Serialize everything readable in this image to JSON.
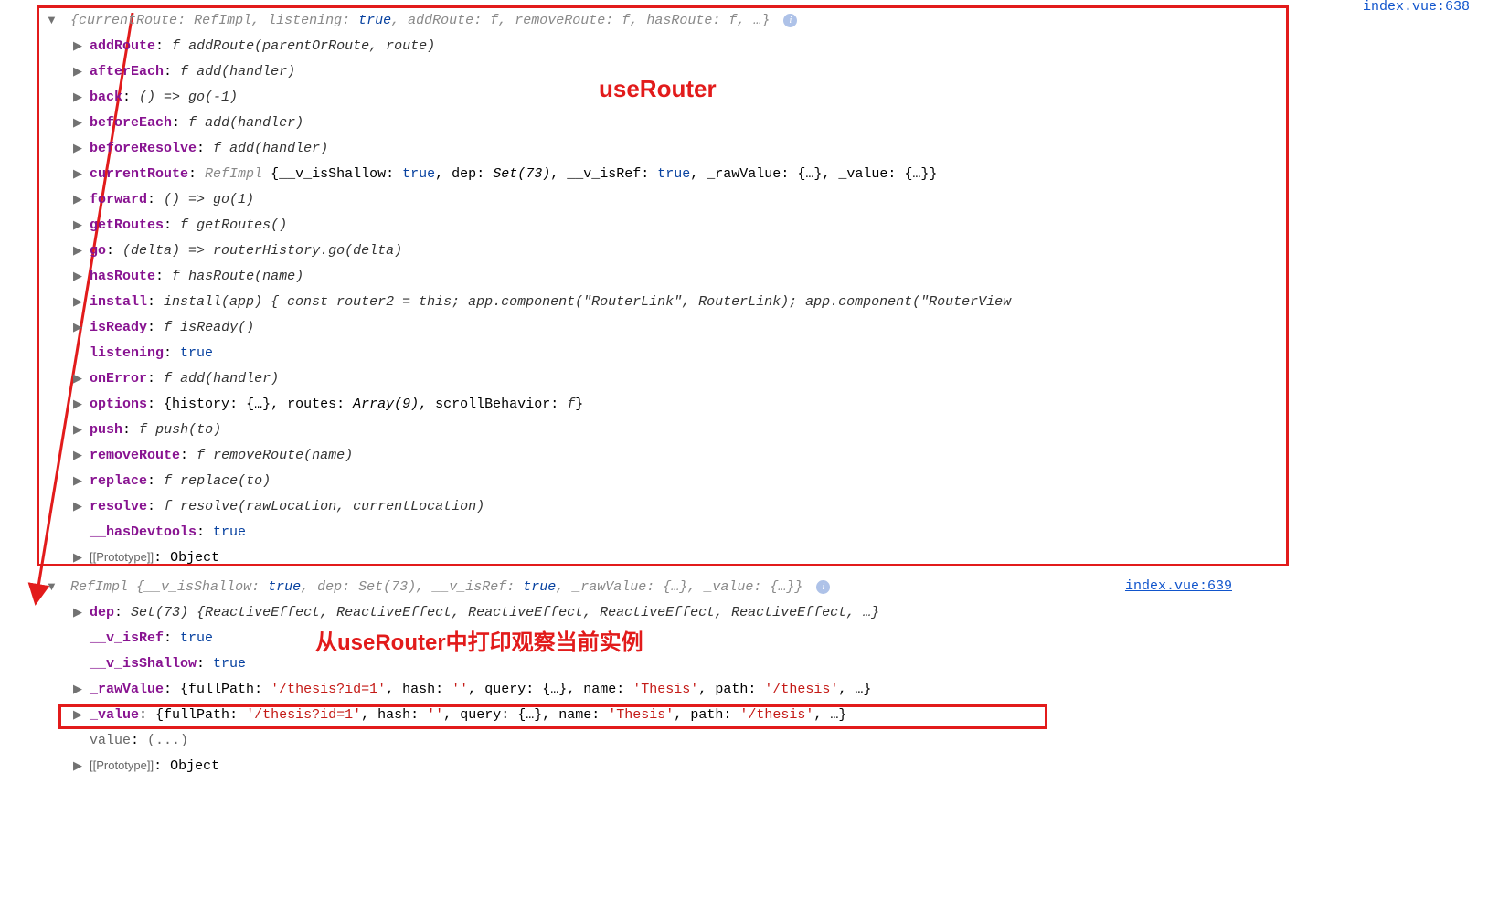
{
  "sourceFile": "index.vue:",
  "sourceLine1": "638",
  "sourceLink2": "index.vue:639",
  "annotations": {
    "big1": "useRouter",
    "big2": "从useRouter中打印观察当前实例"
  },
  "obj1Summary": {
    "prefix": "{",
    "k1": "currentRoute",
    "v1": "RefImpl",
    "k2": "listening",
    "v2": "true",
    "k3": "addRoute",
    "v3": "f",
    "k4": "removeRoute",
    "v4": "f",
    "k5": "hasRoute",
    "v5": "f",
    "suffix": ", …}"
  },
  "props": {
    "addRoute": {
      "key": "addRoute",
      "f": "f",
      "val": "addRoute(parentOrRoute, route)"
    },
    "afterEach": {
      "key": "afterEach",
      "f": "f",
      "val": "add(handler)"
    },
    "back": {
      "key": "back",
      "val": "() => go(-1)"
    },
    "beforeEach": {
      "key": "beforeEach",
      "f": "f",
      "val": "add(handler)"
    },
    "beforeResolve": {
      "key": "beforeResolve",
      "f": "f",
      "val": "add(handler)"
    },
    "currentRoute": {
      "key": "currentRoute",
      "type": "RefImpl"
    },
    "currentRouteInline": {
      "k1": "__v_isShallow",
      "v1": "true",
      "k2": "dep",
      "v2": "Set(73)",
      "k3": "__v_isRef",
      "v3": "true",
      "k4": "_rawValue",
      "v4": "{…}",
      "k5": "_value",
      "v5": "{…}"
    },
    "forward": {
      "key": "forward",
      "val": "() => go(1)"
    },
    "getRoutes": {
      "key": "getRoutes",
      "f": "f",
      "val": "getRoutes()"
    },
    "go": {
      "key": "go",
      "val": "(delta) => routerHistory.go(delta)"
    },
    "hasRoute": {
      "key": "hasRoute",
      "f": "f",
      "val": "hasRoute(name)"
    },
    "install": {
      "key": "install",
      "val": "install(app) { const router2 = this; app.component(\"RouterLink\", RouterLink); app.component(\"RouterView"
    },
    "isReady": {
      "key": "isReady",
      "f": "f",
      "val": "isReady()"
    },
    "listening": {
      "key": "listening",
      "val": "true"
    },
    "onError": {
      "key": "onError",
      "f": "f",
      "val": "add(handler)"
    },
    "options": {
      "key": "options"
    },
    "optionsInline": {
      "k1": "history",
      "v1": "{…}",
      "k2": "routes",
      "v2": "Array(9)",
      "k3": "scrollBehavior",
      "v3": "f"
    },
    "push": {
      "key": "push",
      "f": "f",
      "val": "push(to)"
    },
    "removeRoute": {
      "key": "removeRoute",
      "f": "f",
      "val": "removeRoute(name)"
    },
    "replace": {
      "key": "replace",
      "f": "f",
      "val": "replace(to)"
    },
    "resolve": {
      "key": "resolve",
      "f": "f",
      "val": "resolve(rawLocation, currentLocation)"
    },
    "hasDevtools": {
      "key": "__hasDevtools",
      "val": "true"
    },
    "proto": {
      "key": "[[Prototype]]",
      "val": "Object"
    }
  },
  "obj2Summary": {
    "type": "RefImpl",
    "k1": "__v_isShallow",
    "v1": "true",
    "k2": "dep",
    "v2": "Set(73)",
    "k3": "__v_isRef",
    "v3": "true",
    "k4": "_rawValue",
    "v4": "{…}",
    "k5": "_value",
    "v5": "{…}"
  },
  "obj2Props": {
    "dep": {
      "key": "dep",
      "type": "Set(73)",
      "val": "{ReactiveEffect, ReactiveEffect, ReactiveEffect, ReactiveEffect, ReactiveEffect, …}"
    },
    "isRef": {
      "key": "__v_isRef",
      "val": "true"
    },
    "isShallow": {
      "key": "__v_isShallow",
      "val": "true"
    },
    "rawValue": {
      "key": "_rawValue"
    },
    "rawValueInline": {
      "k1": "fullPath",
      "v1": "'/thesis?id=1'",
      "k2": "hash",
      "v2": "''",
      "k3": "query",
      "v3": "{…}",
      "k4": "name",
      "v4": "'Thesis'",
      "k5": "path",
      "v5": "'/thesis'"
    },
    "value": {
      "key": "_value"
    },
    "valueInline": {
      "k1": "fullPath",
      "v1": "'/thesis?id=1'",
      "k2": "hash",
      "v2": "''",
      "k3": "query",
      "v3": "{…}",
      "k4": "name",
      "v4": "'Thesis'",
      "k5": "path",
      "v5": "'/thesis'"
    },
    "value2": {
      "key": "value",
      "val": "(...)"
    },
    "proto": {
      "key": "[[Prototype]]",
      "val": "Object"
    }
  }
}
